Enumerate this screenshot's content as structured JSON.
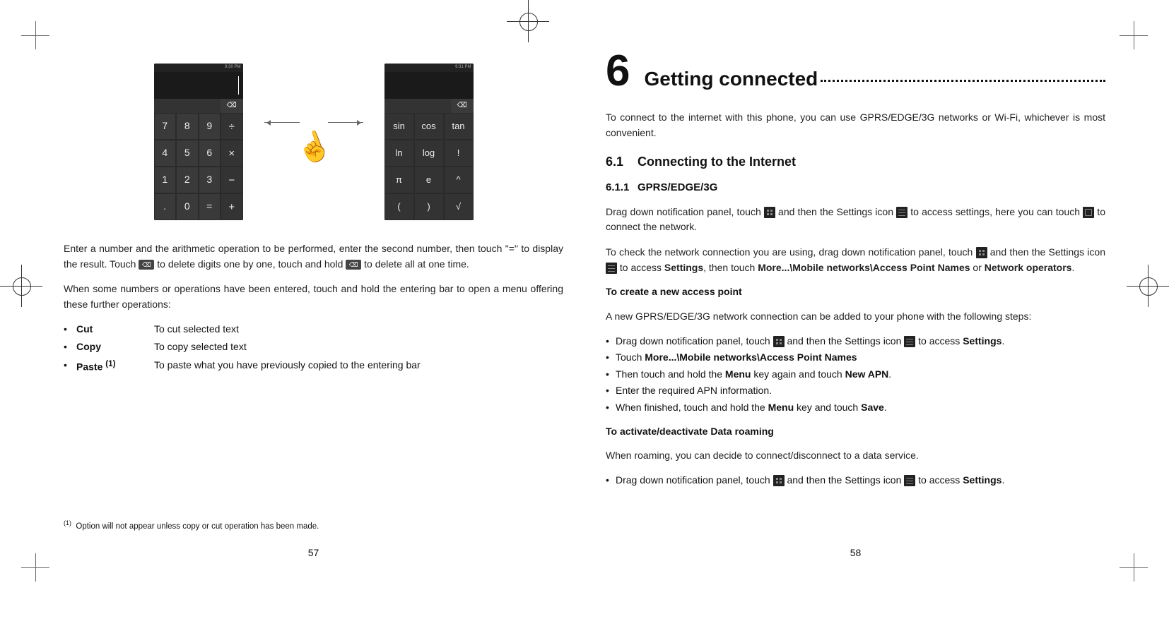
{
  "left": {
    "calc_basic": {
      "status": "9:30 PM",
      "keys": [
        "7",
        "8",
        "9",
        "÷",
        "4",
        "5",
        "6",
        "×",
        "1",
        "2",
        "3",
        "−",
        ".",
        "0",
        "=",
        "+"
      ]
    },
    "calc_adv": {
      "status": "9:31 PM",
      "keys": [
        "sin",
        "cos",
        "tan",
        "ln",
        "log",
        "!",
        "π",
        "e",
        "^",
        "(",
        ")",
        "√"
      ]
    },
    "para1_a": "Enter a number and the arithmetic operation to be performed, enter the second number, then touch \"=\" to display the result. Touch ",
    "para1_b": " to delete digits one by one, touch and hold ",
    "para1_c": " to delete all at one time.",
    "para2": "When some numbers or operations have been entered, touch and hold the entering bar to open a menu offering these further operations:",
    "ops": [
      {
        "term": "Cut",
        "desc": "To cut selected text"
      },
      {
        "term": "Copy",
        "desc": "To copy selected text"
      },
      {
        "term": "Paste ",
        "sup": "(1)",
        "desc": "To paste what you have previously copied to the entering bar"
      }
    ],
    "footnote_sup": "(1)",
    "footnote": "Option will not appear unless copy or cut operation has been made.",
    "pagenum": "57"
  },
  "right": {
    "chapter_num": "6",
    "chapter_title": "Getting connected",
    "intro": "To connect to the internet with this phone, you can use GPRS/EDGE/3G networks or Wi-Fi, whichever is most convenient.",
    "h2_num": "6.1",
    "h2_title": "Connecting to the Internet",
    "h3_num": "6.1.1",
    "h3_title": "GPRS/EDGE/3G",
    "p1_a": "Drag down notification panel, touch ",
    "p1_b": " and then the Settings icon ",
    "p1_c": " to access settings, here you can touch ",
    "p1_d": " to connect the network.",
    "p2_a": "To check the network connection you are using, drag down notification panel, touch ",
    "p2_b": " and then the Settings icon ",
    "p2_c": " to access ",
    "p2_settings": "Settings",
    "p2_d": ", then touch ",
    "p2_path": "More...\\Mobile networks\\Access Point Names",
    "p2_e": " or ",
    "p2_netops": "Network operators",
    "p2_f": ".",
    "h4a": "To create a new access point",
    "p3": "A new GPRS/EDGE/3G network connection can be added to your phone with the following steps:",
    "bul1_a": "Drag down notification panel, touch ",
    "bul1_b": " and then the Settings icon ",
    "bul1_c": " to access ",
    "bul1_settings": "Settings",
    "bul1_d": ".",
    "bul2_a": "Touch ",
    "bul2_path": "More...\\Mobile networks\\Access Point Names",
    "bul3_a": "Then touch and hold the ",
    "bul3_menu": "Menu",
    "bul3_b": " key again and touch ",
    "bul3_newapn": "New APN",
    "bul3_c": ".",
    "bul4": "Enter the required APN information.",
    "bul5_a": "When finished, touch and hold the ",
    "bul5_menu": "Menu",
    "bul5_b": " key and touch ",
    "bul5_save": "Save",
    "bul5_c": ".",
    "h4b": "To activate/deactivate Data roaming",
    "p4": "When roaming, you can decide to connect/disconnect to a data service.",
    "bul6_a": "Drag down notification panel, touch ",
    "bul6_b": " and then the Settings icon ",
    "bul6_c": " to access ",
    "bul6_settings": "Settings",
    "bul6_d": ".",
    "pagenum": "58"
  }
}
